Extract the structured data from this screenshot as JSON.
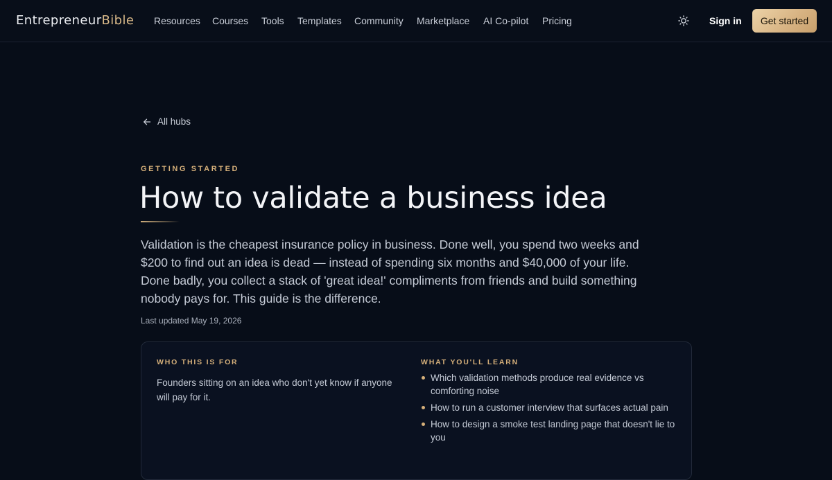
{
  "brand": {
    "part1": "Entrepreneur",
    "part2": "Bible"
  },
  "nav": {
    "items": [
      {
        "label": "Resources",
        "id": "resources"
      },
      {
        "label": "Courses",
        "id": "courses"
      },
      {
        "label": "Tools",
        "id": "tools"
      },
      {
        "label": "Templates",
        "id": "templates"
      },
      {
        "label": "Community",
        "id": "community"
      },
      {
        "label": "Marketplace",
        "id": "marketplace"
      },
      {
        "label": "AI Co-pilot",
        "id": "ai-co-pilot"
      },
      {
        "label": "Pricing",
        "id": "pricing"
      }
    ],
    "theme_icon": "sun-icon",
    "signin_label": "Sign in",
    "cta_label": "Get started"
  },
  "page": {
    "back_label": "All hubs",
    "back_icon": "arrow-left-icon",
    "eyebrow": "GETTING STARTED",
    "title": "How to validate a business idea",
    "lead": "Validation is the cheapest insurance policy in business. Done well, you spend two weeks and $200 to find out an idea is dead — instead of spending six months and $40,000 of your life. Done badly, you collect a stack of 'great idea!' compliments from friends and build something nobody pays for. This guide is the difference.",
    "updated": "Last updated May 19, 2026"
  },
  "card": {
    "who_label": "WHO THIS IS FOR",
    "who_text": "Founders sitting on an idea who don't yet know if anyone will pay for it.",
    "learn_label": "WHAT YOU'LL LEARN",
    "learn_items": [
      "Which validation methods produce real evidence vs comforting noise",
      "How to run a customer interview that surfaces actual pain",
      "How to design a smoke test landing page that doesn't lie to you"
    ]
  },
  "colors": {
    "background": "#070d18",
    "accent_gold": "#d6b07a",
    "cta_gold": "#dcb887",
    "text_primary": "#f3f4f7",
    "text_muted": "#c4cad5"
  }
}
